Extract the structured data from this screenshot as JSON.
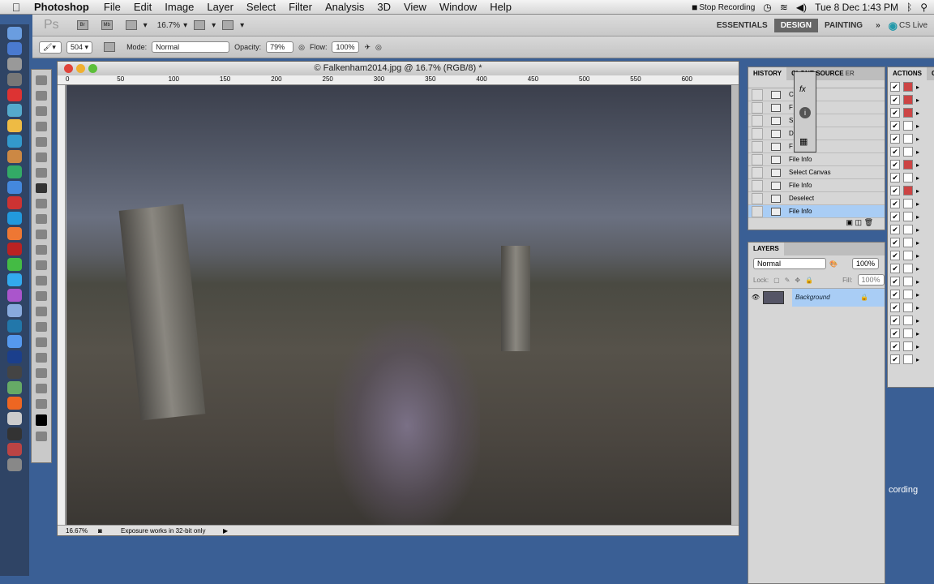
{
  "menubar": {
    "app": "Photoshop",
    "items": [
      "File",
      "Edit",
      "Image",
      "Layer",
      "Select",
      "Filter",
      "Analysis",
      "3D",
      "View",
      "Window",
      "Help"
    ],
    "tray": {
      "recording": "Stop Recording",
      "datetime": "Tue 8 Dec  1:43 PM"
    }
  },
  "appbar": {
    "logo": "Ps",
    "zoom": "16.7%",
    "bridge": "Br",
    "minibridge": "Mb",
    "workspaces": [
      "ESSENTIALS",
      "DESIGN",
      "PAINTING"
    ],
    "active_workspace": "DESIGN",
    "more": "»",
    "cslive": "CS Live"
  },
  "options": {
    "brush_size": "504",
    "mode_label": "Mode:",
    "mode": "Normal",
    "opacity_label": "Opacity:",
    "opacity": "79%",
    "flow_label": "Flow:",
    "flow": "100%"
  },
  "document": {
    "title": "© Falkenham2014.jpg @ 16.7% (RGB/8) *",
    "ruler": [
      "0",
      "50",
      "100",
      "150",
      "200",
      "250",
      "300",
      "350",
      "400",
      "450",
      "500",
      "550",
      "600"
    ],
    "status_zoom": "16.67%",
    "status_text": "Exposure works in 32-bit only"
  },
  "history": {
    "tabs": [
      "HISTORY",
      "CLONE SOURCE"
    ],
    "visible_tab2": "ER",
    "items": [
      "C",
      "F",
      "S         vas",
      "D",
      "F",
      "File Info",
      "Select Canvas",
      "File Info",
      "Deselect",
      "File Info"
    ],
    "current_index": 9
  },
  "actions": {
    "tabs": [
      "ACTIONS",
      "CH"
    ]
  },
  "layers": {
    "tab": "LAYERS",
    "blend": "Normal",
    "opacity": "100%",
    "lock_label": "Lock:",
    "fill_label": "Fill:",
    "fill": "100%",
    "layer_name": "Background"
  },
  "desktop": {
    "partial_label": "cording"
  },
  "colors": {
    "desktop": "#3a5f95",
    "selection": "#a9cdf5",
    "workspace_active": "#666666"
  }
}
